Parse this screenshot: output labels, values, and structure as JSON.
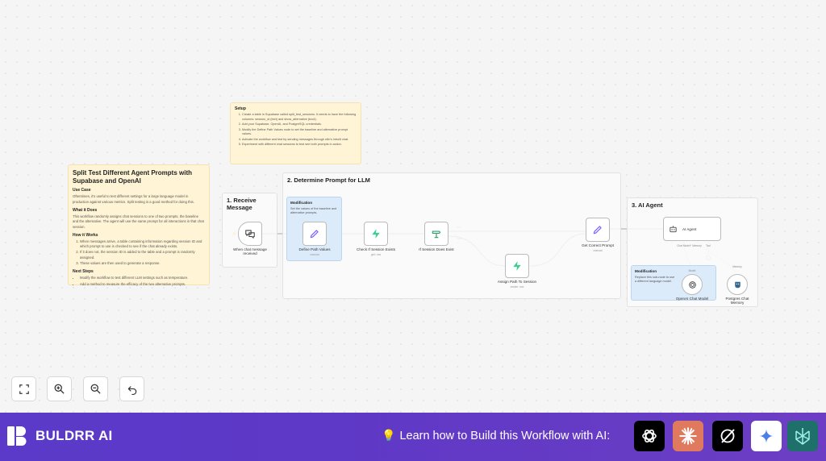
{
  "canvas": {
    "main_note": {
      "title": "Split Test Different Agent Prompts with Supabase and OpenAI",
      "sections": [
        {
          "heading": "Use Case",
          "body": "Oftentimes, it's useful to test different settings for a large language model in production against various metrics. Split testing is a good method for doing this."
        },
        {
          "heading": "What it Does",
          "body": "This workflow randomly assigns chat sessions to one of two prompts, the baseline and the alternative. The agent will use the same prompt for all interactions in that chat session."
        },
        {
          "heading": "How it Works",
          "list": [
            "When messages arrive, a table containing information regarding session ID and which prompt to use is checked to see if the chat already exists.",
            "If it does not, the session ID is added to the table and a prompt is randomly assigned.",
            "These values are then used to generate a response."
          ]
        },
        {
          "heading": "Next Steps",
          "list": [
            "Modify the workflow to test different LLM settings such as temperature.",
            "Add a method to measure the efficacy of the two alternative prompts."
          ]
        }
      ]
    },
    "setup_note": {
      "title": "Setup",
      "items": [
        "Create a table in Supabase called split_test_sessions. It needs to have the following columns: session_id (text) and show_alternative (bool).",
        "Add your Supabase, OpenAI, and PostgreSQL credentials.",
        "Modify the Define Path Values node to set the baseline and alternative prompt values.",
        "Activate the workflow and test by sending messages through n8n's inbuilt chat.",
        "Experiment with different chat sessions to test see both prompts in action."
      ]
    },
    "section1": {
      "title": "1. Receive Message"
    },
    "section2": {
      "title": "2. Determine Prompt for LLM"
    },
    "section3": {
      "title": "3. AI Agent"
    },
    "mod_note_1": {
      "title": "Modification",
      "body": "Set the values of the baseline and alternative prompts."
    },
    "mod_note_2": {
      "title": "Modification",
      "body": "Replace this sub-node to use a different language model."
    },
    "nodes": {
      "trigger": {
        "label": "When chat message received"
      },
      "define": {
        "label": "Define Path Values",
        "sub": "manual"
      },
      "check": {
        "label": "Check If Session Exists",
        "sub": "get: row"
      },
      "if": {
        "label": "If Session Does Exist",
        "true_label": "true",
        "false_label": "false"
      },
      "assign": {
        "label": "Assign Path To Session",
        "sub": "create: row"
      },
      "get_prompt": {
        "label": "Get Correct Prompt",
        "sub": "manual"
      },
      "agent": {
        "label": "AI Agent",
        "port_model": "Chat Model*",
        "port_memory": "Memory",
        "port_tool": "Tool"
      },
      "openai": {
        "label": "OpenAI Chat Model",
        "port": "Model"
      },
      "postgres": {
        "label": "Postgres Chat Memory",
        "port": "Memory"
      }
    }
  },
  "controls": {
    "fit": "fit-view-icon",
    "zoom_in": "zoom-in-icon",
    "zoom_out": "zoom-out-icon",
    "undo": "undo-icon"
  },
  "banner": {
    "brand": "BULDRR AI",
    "cta": "Learn how to Build this Workflow with AI:",
    "ai_tools": [
      "chatgpt-icon",
      "claude-icon",
      "grok-icon",
      "gemini-icon",
      "perplexity-icon"
    ],
    "colors": {
      "banner": "#5b3ac9",
      "claude": "#e07a5f",
      "perplexity": "#1f6f6a"
    }
  }
}
